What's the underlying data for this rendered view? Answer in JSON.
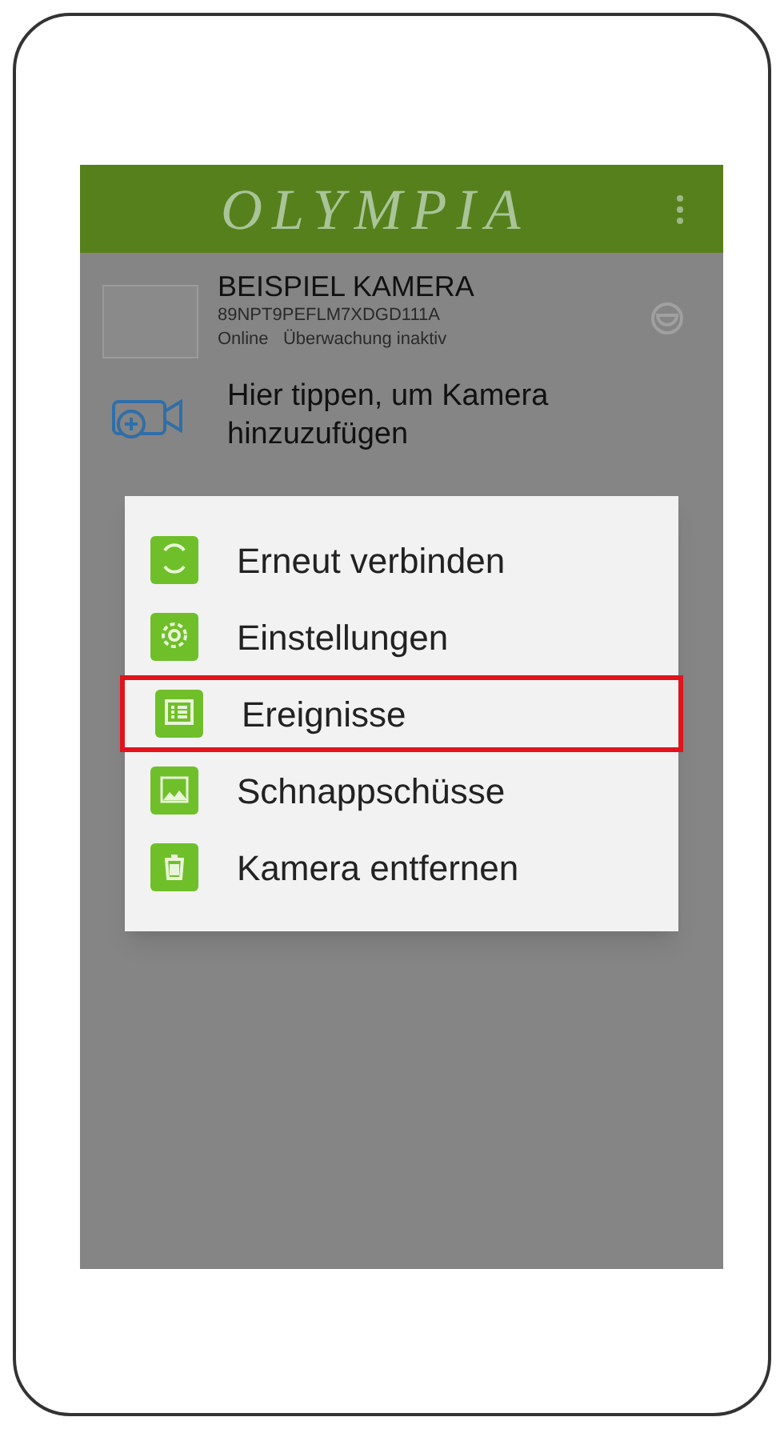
{
  "app_bar": {
    "title": "OLYMPIA"
  },
  "camera": {
    "name": "BEISPIEL KAMERA",
    "serial": "89NPT9PEFLM7XDGD111A",
    "status": "Online   Überwachung inaktiv"
  },
  "add_camera": {
    "label": "Hier tippen, um Kamera hinzuzufügen"
  },
  "menu": {
    "items": [
      {
        "kind": "reconnect",
        "label": "Erneut verbinden",
        "highlighted": false
      },
      {
        "kind": "settings",
        "label": "Einstellungen",
        "highlighted": false
      },
      {
        "kind": "events",
        "label": "Ereignisse",
        "highlighted": true
      },
      {
        "kind": "snapshots",
        "label": "Schnappschüsse",
        "highlighted": false
      },
      {
        "kind": "remove",
        "label": "Kamera entfernen",
        "highlighted": false
      }
    ]
  }
}
